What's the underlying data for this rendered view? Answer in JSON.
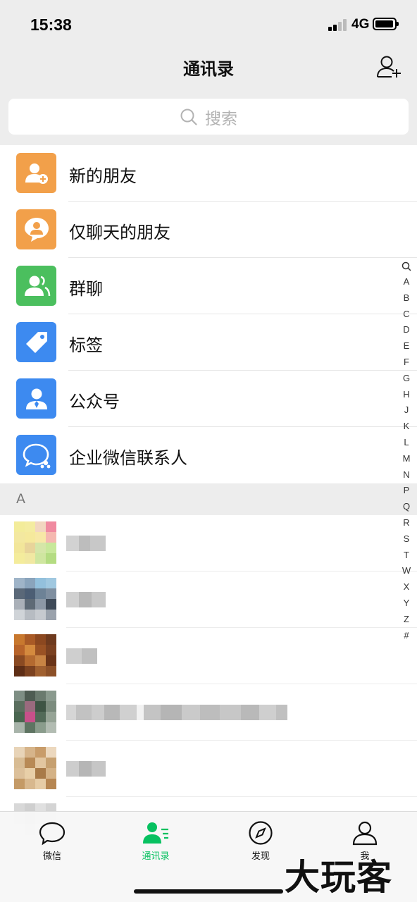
{
  "status_bar": {
    "time": "15:38",
    "network": "4G"
  },
  "header": {
    "title": "通讯录"
  },
  "search": {
    "placeholder": "搜索"
  },
  "functions": [
    {
      "label": "新的朋友",
      "icon": "add-friend-icon",
      "color": "#f2a04a"
    },
    {
      "label": "仅聊天的朋友",
      "icon": "chat-only-icon",
      "color": "#f2a04a"
    },
    {
      "label": "群聊",
      "icon": "group-chat-icon",
      "color": "#4bbf5e"
    },
    {
      "label": "标签",
      "icon": "tag-icon",
      "color": "#3d8af0"
    },
    {
      "label": "公众号",
      "icon": "official-account-icon",
      "color": "#3d8af0"
    },
    {
      "label": "企业微信联系人",
      "icon": "wecom-icon",
      "color": "#3d8af0"
    }
  ],
  "section_header": "A",
  "contacts_note": "contact names and avatars are pixelated in the screenshot",
  "index_letters": [
    "A",
    "B",
    "C",
    "D",
    "E",
    "F",
    "G",
    "H",
    "J",
    "K",
    "L",
    "M",
    "N",
    "P",
    "Q",
    "R",
    "S",
    "T",
    "W",
    "X",
    "Y",
    "Z",
    "#"
  ],
  "tabs": [
    {
      "label": "微信",
      "icon": "chat-icon"
    },
    {
      "label": "通讯录",
      "icon": "contacts-icon",
      "active": true
    },
    {
      "label": "发现",
      "icon": "compass-icon"
    },
    {
      "label": "我",
      "icon": "profile-icon"
    }
  ],
  "watermark": "大玩客",
  "colors": {
    "accent": "#07c160",
    "header_bg": "#ededed"
  }
}
